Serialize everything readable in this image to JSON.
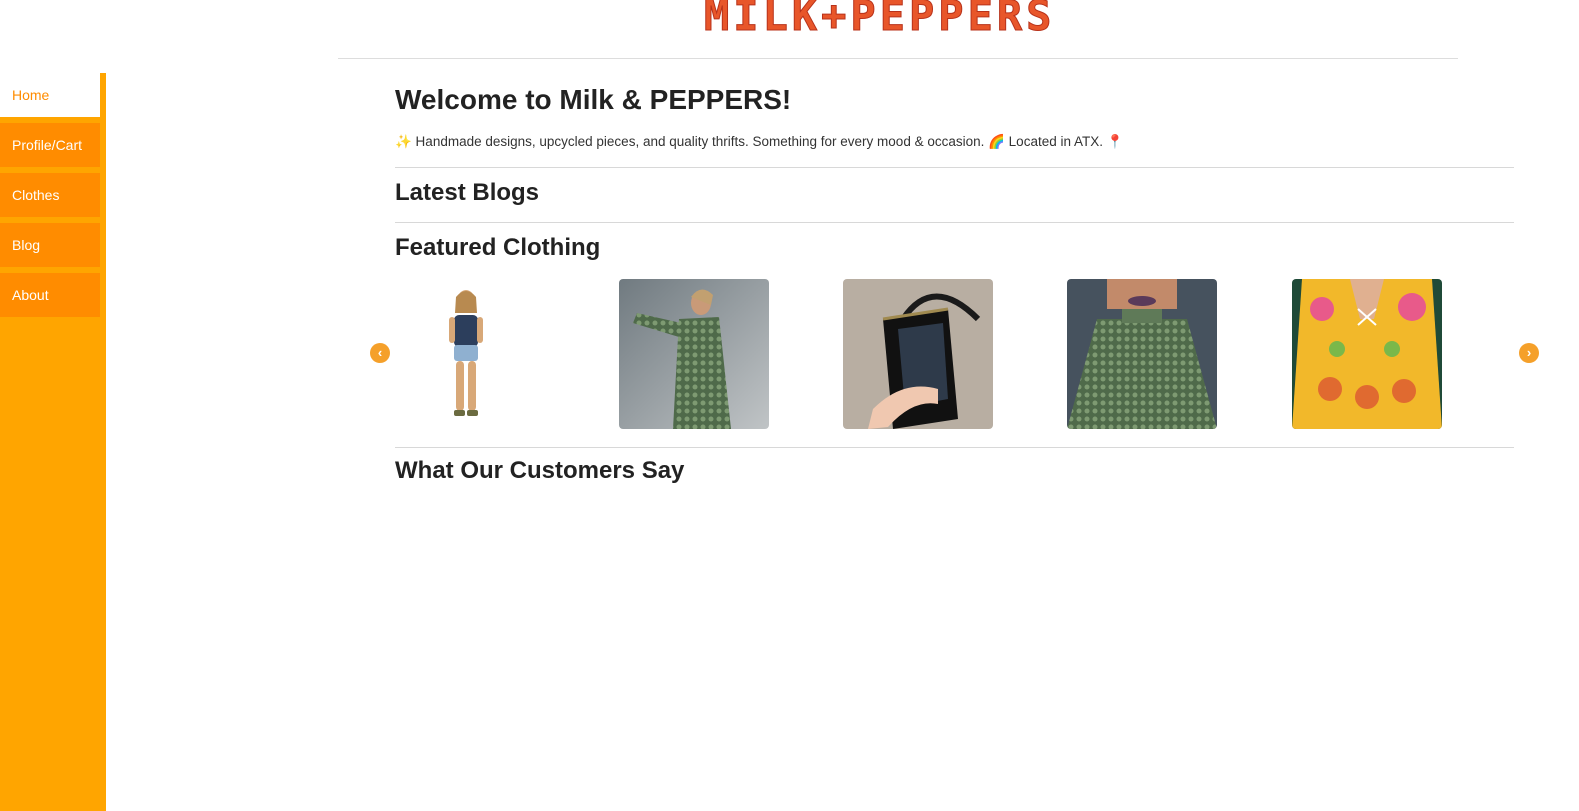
{
  "header": {
    "logo_text": "MILK+PEPPERS"
  },
  "sidebar": {
    "items": [
      {
        "label": "Home",
        "active": true
      },
      {
        "label": "Profile/Cart",
        "active": false
      },
      {
        "label": "Clothes",
        "active": false
      },
      {
        "label": "Blog",
        "active": false
      },
      {
        "label": "About",
        "active": false
      }
    ]
  },
  "main": {
    "welcome_title": "Welcome to Milk & PEPPERS!",
    "tagline": "✨ Handmade designs, upcycled pieces, and quality thrifts. Something for every mood & occasion. 🌈 Located in ATX. 📍",
    "latest_blogs_title": "Latest Blogs",
    "featured_title": "Featured Clothing",
    "testimonials_title": "What Our Customers Say"
  },
  "carousel": {
    "prev_icon": "chevron-left-icon",
    "next_icon": "chevron-right-icon",
    "items": [
      {
        "image": "woman-denim-top-and-shorts"
      },
      {
        "image": "green-snakeskin-cardigan"
      },
      {
        "image": "black-handbag-open"
      },
      {
        "image": "green-snakeskin-blouse-closeup"
      },
      {
        "image": "yellow-floral-print-top"
      }
    ]
  },
  "colors": {
    "sidebar_bg": "#ffa500",
    "nav_item_bg": "#ff8c00",
    "active_text": "#ff8c00",
    "logo": "#e8562a",
    "arrow": "#f5a02a"
  }
}
